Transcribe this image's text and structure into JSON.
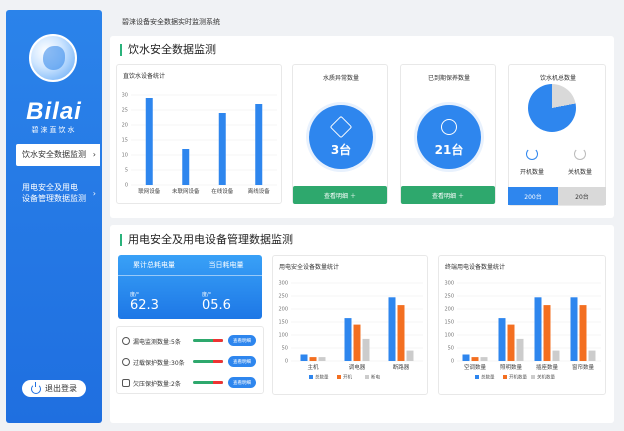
{
  "app": {
    "title": "碧涞设备安全数据实时监测系统",
    "logo_text": "Bilai",
    "logo_sub": "碧涞直饮水"
  },
  "sidebar": {
    "items": [
      {
        "label": "饮水安全数据监测",
        "active": true
      },
      {
        "label_line1": "用电安全及用电",
        "label_line2": "设备管理数据监测",
        "active": false
      }
    ],
    "logout_label": "退出登录"
  },
  "water": {
    "section_title": "饮水安全数据监测",
    "device_chart_title": "直饮水设备统计",
    "quality": {
      "title": "水质异常数量",
      "value": "3台",
      "button": "查看明细 ＋"
    },
    "maintenance": {
      "title": "已到期保养数量",
      "value": "21台",
      "button": "查看明细 ＋"
    },
    "machines": {
      "title": "饮水机总数量",
      "on_label": "开机数量",
      "off_label": "关机数量",
      "on_value": "200台",
      "off_value": "20台"
    }
  },
  "power": {
    "section_title": "用电安全及用电设备管理数据监测",
    "energy": {
      "total_label": "累计总耗电量",
      "today_label": "当日耗电量",
      "unit": "度/°",
      "total_value": "62.3",
      "today_value": "05.6"
    },
    "protections": [
      {
        "label": "漏电监测数量:5条",
        "button": "查看明细"
      },
      {
        "label": "过载保护数量:30条",
        "button": "查看明细"
      },
      {
        "label": "欠压保护数量:2条",
        "button": "查看明细"
      }
    ],
    "safety_chart_title": "用电安全设备数量统计",
    "terminal_chart_title": "终端用电设备数量统计"
  },
  "colors": {
    "primary": "#2e86ee",
    "green": "#2ea86d",
    "orange": "#f36f21",
    "gray": "#cccccc",
    "sidebar": "#1f6fe0"
  },
  "chart_data": [
    {
      "type": "bar",
      "title": "直饮水设备统计",
      "categories": [
        "联网设备",
        "未联网设备",
        "在线设备",
        "离线设备"
      ],
      "values": [
        29,
        12,
        24,
        27
      ],
      "ylim": [
        0,
        30
      ],
      "yticks": [
        0,
        5,
        10,
        15,
        20,
        25,
        30
      ]
    },
    {
      "type": "bar",
      "title": "用电安全设备数量统计",
      "categories": [
        "主机",
        "调电器",
        "断路器"
      ],
      "series": [
        {
          "name": "总数量",
          "values": [
            25,
            165,
            245
          ]
        },
        {
          "name": "开机",
          "values": [
            15,
            140,
            215
          ]
        },
        {
          "name": "断电",
          "values": [
            15,
            85,
            40
          ]
        }
      ],
      "ylim": [
        0,
        300
      ],
      "yticks": [
        0,
        50,
        100,
        150,
        200,
        250,
        300
      ]
    },
    {
      "type": "bar",
      "title": "终端用电设备数量统计",
      "categories": [
        "空调数量",
        "照明数量",
        "插座数量",
        "窗帘数量"
      ],
      "series": [
        {
          "name": "总数量",
          "values": [
            25,
            165,
            245,
            245
          ]
        },
        {
          "name": "开机数量",
          "values": [
            15,
            140,
            215,
            215
          ]
        },
        {
          "name": "关机数量",
          "values": [
            15,
            85,
            40,
            40
          ]
        }
      ],
      "ylim": [
        0,
        300
      ],
      "yticks": [
        0,
        50,
        100,
        150,
        200,
        250,
        300
      ]
    }
  ]
}
